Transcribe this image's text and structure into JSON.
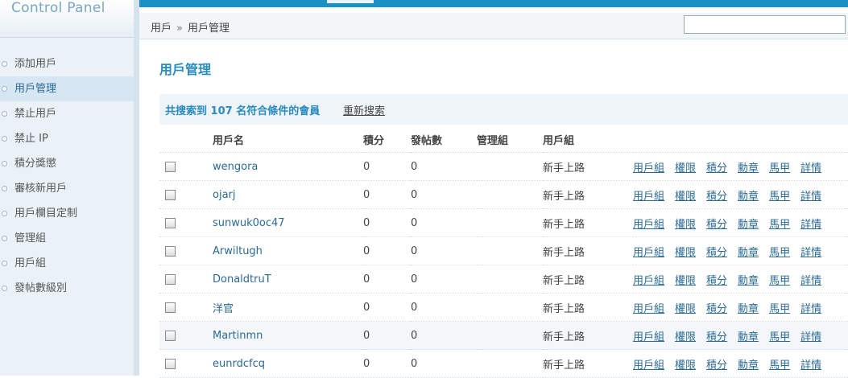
{
  "sidebar": {
    "brand": "Control Panel",
    "items": [
      {
        "label": "添加用戶"
      },
      {
        "label": "用戶管理"
      },
      {
        "label": "禁止用戶"
      },
      {
        "label": "禁止 IP"
      },
      {
        "label": "積分獎懲"
      },
      {
        "label": "審核新用戶"
      },
      {
        "label": "用戶欄目定制"
      },
      {
        "label": "管理組"
      },
      {
        "label": "用戶組"
      },
      {
        "label": "發帖數級別"
      }
    ],
    "active_index": 1
  },
  "breadcrumb": {
    "root": "用戶",
    "separator": "»",
    "current": "用戶管理"
  },
  "search": {
    "value": "",
    "placeholder": ""
  },
  "main": {
    "title": "用戶管理",
    "result_text": "共搜索到 107 名符合條件的會員",
    "research_link": "重新搜索"
  },
  "table": {
    "headers": {
      "username": "用戶名",
      "credits": "積分",
      "posts": "發帖數",
      "admin_group": "管理組",
      "user_group": "用戶組"
    },
    "actions": [
      "用戶組",
      "權限",
      "積分",
      "勳章",
      "馬甲",
      "詳情"
    ],
    "rows": [
      {
        "username": "wengora",
        "credits": "0",
        "posts": "0",
        "admin_group": "",
        "user_group": "新手上路"
      },
      {
        "username": "ojarj",
        "credits": "0",
        "posts": "0",
        "admin_group": "",
        "user_group": "新手上路"
      },
      {
        "username": "sunwuk0oc47",
        "credits": "0",
        "posts": "0",
        "admin_group": "",
        "user_group": "新手上路"
      },
      {
        "username": "Arwiltugh",
        "credits": "0",
        "posts": "0",
        "admin_group": "",
        "user_group": "新手上路"
      },
      {
        "username": "DonaldtruT",
        "credits": "0",
        "posts": "0",
        "admin_group": "",
        "user_group": "新手上路"
      },
      {
        "username": "洋官",
        "credits": "0",
        "posts": "0",
        "admin_group": "",
        "user_group": "新手上路"
      },
      {
        "username": "Martinmn",
        "credits": "0",
        "posts": "0",
        "admin_group": "",
        "user_group": "新手上路"
      },
      {
        "username": "eunrdcfcq",
        "credits": "0",
        "posts": "0",
        "admin_group": "",
        "user_group": "新手上路"
      }
    ],
    "highlighted_row": 6
  }
}
